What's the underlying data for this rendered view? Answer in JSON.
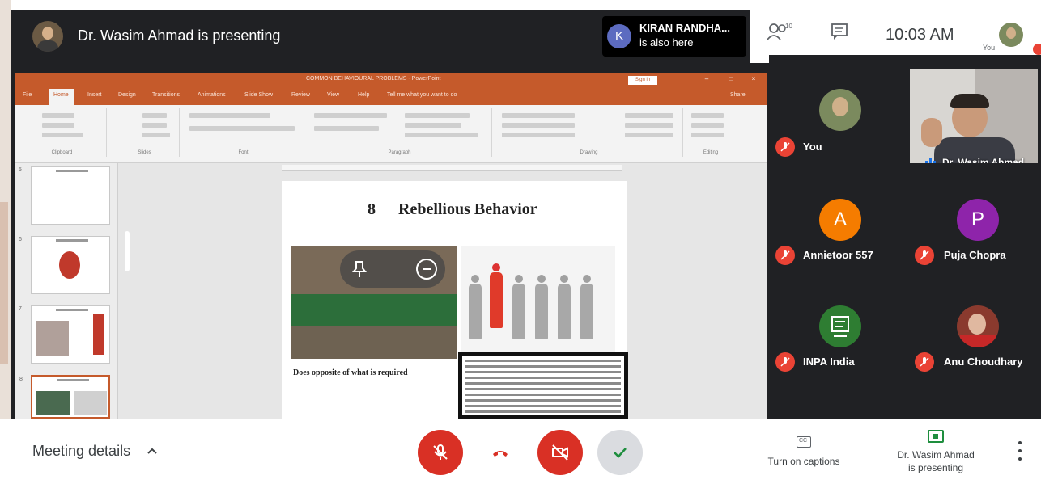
{
  "topbar": {
    "presenting_text": "Dr. Wasim Ahmad is presenting",
    "also_here": {
      "initial": "K",
      "name": "KIRAN RANDHA...",
      "status": "is also here"
    },
    "people_count": "10",
    "time": "10:03 AM",
    "self_label": "You"
  },
  "slide": {
    "number": "8",
    "title": "Rebellious Behavior",
    "caption": "Does opposite of what is required"
  },
  "participants": [
    {
      "name": "You",
      "type": "photo"
    },
    {
      "name": "Dr. Wasim Ahmad",
      "type": "video"
    },
    {
      "name": "Annietoor 557",
      "initial": "A",
      "color": "#f57c00"
    },
    {
      "name": "Puja Chopra",
      "initial": "P",
      "color": "#8e24aa"
    },
    {
      "name": "INPA India",
      "type": "logo",
      "color": "#2e7d32"
    },
    {
      "name": "Anu Choudhary",
      "type": "photo"
    }
  ],
  "bottombar": {
    "meeting_details": "Meeting details",
    "captions_label": "Turn on captions",
    "presenting_line1": "Dr. Wasim Ahmad",
    "presenting_line2": "is presenting"
  },
  "colors": {
    "accent_red": "#d93025",
    "dark": "#202124",
    "ppt_orange": "#c55a2b"
  }
}
